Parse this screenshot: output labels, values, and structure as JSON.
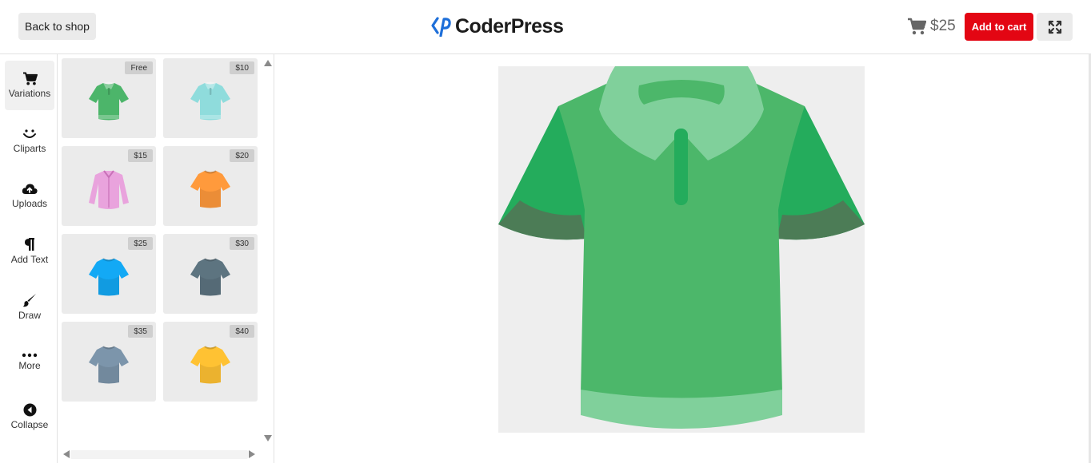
{
  "header": {
    "back_label": "Back to shop",
    "logo_text": "CoderPress",
    "cart_total": "$25",
    "add_to_cart_label": "Add to cart",
    "accent_color": "#e30613",
    "logo_color": "#1e6fd9"
  },
  "toolbar": {
    "items": [
      {
        "label": "Variations",
        "icon": "cart-icon",
        "active": true
      },
      {
        "label": "Cliparts",
        "icon": "smile-icon"
      },
      {
        "label": "Uploads",
        "icon": "cloud-upload-icon"
      },
      {
        "label": "Add Text",
        "icon": "pilcrow-icon"
      },
      {
        "label": "Draw",
        "icon": "brush-icon"
      },
      {
        "label": "More",
        "icon": "ellipsis-icon"
      },
      {
        "label": "Collapse",
        "icon": "collapse-icon"
      }
    ]
  },
  "variations": [
    {
      "price": "Free",
      "kind": "polo",
      "color": "#4cb56a"
    },
    {
      "price": "$10",
      "kind": "polo",
      "color": "#8fdcdc"
    },
    {
      "price": "$15",
      "kind": "shirt",
      "color": "#e9a3dd"
    },
    {
      "price": "$20",
      "kind": "tee",
      "color": "#ff9a3c"
    },
    {
      "price": "$25",
      "kind": "tee",
      "color": "#13a9f5"
    },
    {
      "price": "$30",
      "kind": "tee",
      "color": "#5d7480"
    },
    {
      "price": "$35",
      "kind": "tee",
      "color": "#7c95ab"
    },
    {
      "price": "$40",
      "kind": "tee",
      "color": "#ffc233"
    }
  ],
  "canvas": {
    "product": "polo",
    "body_color": "#4cb76a",
    "sleeve_color": "#24ac5c",
    "cuff_color": "#4c7c56",
    "collar_color": "#80d09b",
    "background": "#eeeeee"
  }
}
